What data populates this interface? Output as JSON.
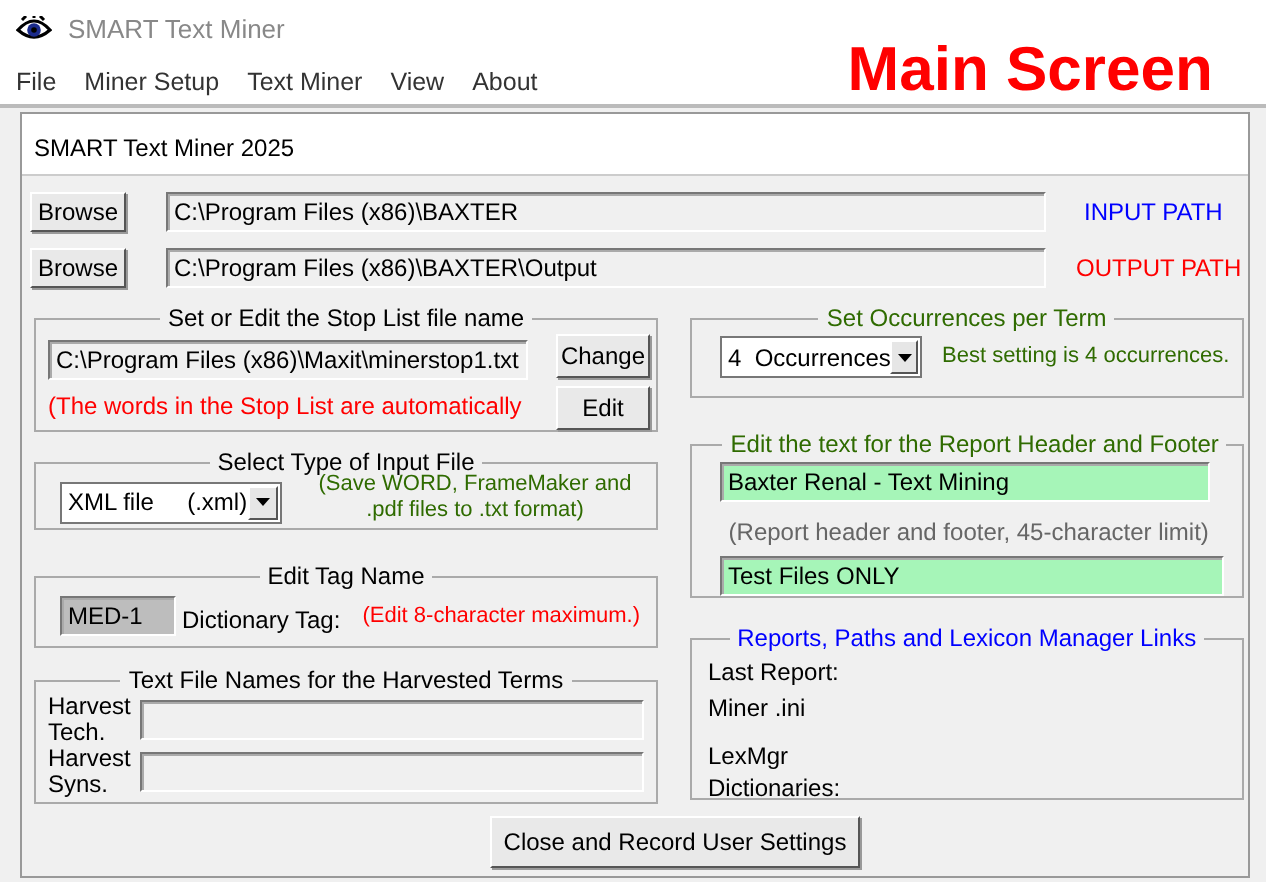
{
  "app": {
    "title": "SMART Text Miner"
  },
  "banner": "Main Screen",
  "menu": [
    "File",
    "Miner Setup",
    "Text Miner",
    "View",
    "About"
  ],
  "panel_title": "SMART Text Miner 2025",
  "paths": [
    {
      "button": "Browse",
      "value": "C:\\Program Files (x86)\\BAXTER",
      "label": "INPUT PATH",
      "color": "#0000ff"
    },
    {
      "button": "Browse",
      "value": "C:\\Program Files (x86)\\BAXTER\\Output",
      "label": "OUTPUT PATH",
      "color": "#ff0000"
    }
  ],
  "stop_list": {
    "title": "Set or Edit the Stop List file name",
    "value": "C:\\Program Files (x86)\\Maxit\\minerstop1.txt",
    "note": "(The words in the Stop List are automatically",
    "buttons": [
      "Change",
      "Edit"
    ]
  },
  "input_type": {
    "title": "Select Type of Input File",
    "value": "XML file     (.xml)",
    "note": "(Save WORD, FrameMaker and .pdf files to .txt format)"
  },
  "tag": {
    "title": "Edit Tag Name",
    "value": "MED-1",
    "label": "Dictionary Tag:",
    "note": "(Edit 8-character maximum.)"
  },
  "harvest": {
    "title": "Text File Names for the Harvested Terms",
    "fields": [
      {
        "label": "Harvest Tech."
      },
      {
        "label": "Harvest Syns."
      }
    ]
  },
  "occurrences": {
    "title": "Set Occurrences per Term",
    "value": "4  Occurrences",
    "note": "Best setting is 4 occurrences."
  },
  "report_text": {
    "title": "Edit the text for the Report Header and Footer",
    "header": "Baxter Renal - Text Mining",
    "hint": "(Report header and footer, 45-character limit)",
    "footer": "Test Files ONLY"
  },
  "links": {
    "title": "Reports, Paths and Lexicon Manager  Links",
    "items": [
      "Last Report:",
      "Miner .ini",
      "LexMgr",
      "Dictionaries:"
    ]
  },
  "close_button": "Close and Record User Settings"
}
